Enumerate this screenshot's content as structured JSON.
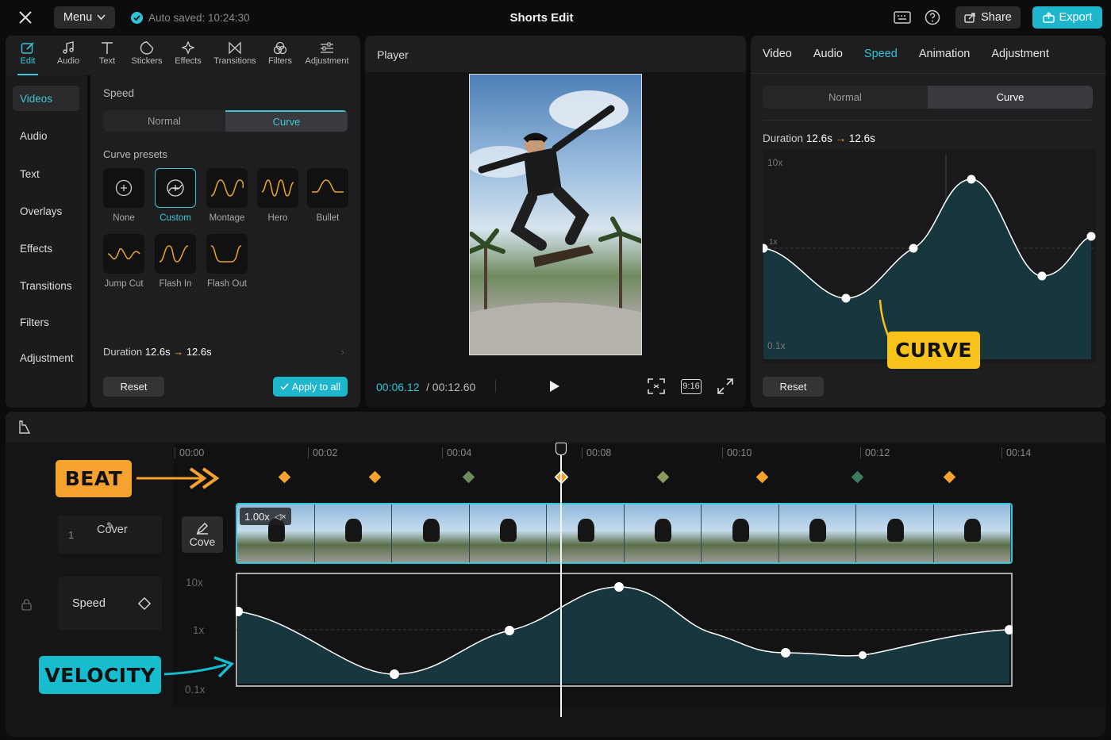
{
  "topbar": {
    "menu_label": "Menu",
    "autosave_text": "Auto saved: 10:24:30",
    "title": "Shorts Edit",
    "share_label": "Share",
    "export_label": "Export"
  },
  "tools": [
    {
      "label": "Edit",
      "icon": "edit-icon"
    },
    {
      "label": "Audio",
      "icon": "music-note-icon"
    },
    {
      "label": "Text",
      "icon": "text-icon"
    },
    {
      "label": "Stickers",
      "icon": "sticker-icon"
    },
    {
      "label": "Effects",
      "icon": "sparkle-icon"
    },
    {
      "label": "Transitions",
      "icon": "transition-icon"
    },
    {
      "label": "Filters",
      "icon": "filter-icon"
    },
    {
      "label": "Adjustment",
      "icon": "sliders-icon"
    }
  ],
  "sidebar": [
    "Videos",
    "Audio",
    "Text",
    "Overlays",
    "Effects",
    "Transitions",
    "Filters",
    "Adjustment"
  ],
  "speed_panel": {
    "heading": "Speed",
    "tab_normal": "Normal",
    "tab_curve": "Curve",
    "presets_heading": "Curve presets",
    "presets": [
      "None",
      "Custom",
      "Montage",
      "Hero",
      "Bullet",
      "Jump Cut",
      "Flash In",
      "Flash Out"
    ],
    "duration_label": "Duration",
    "duration_from": "12.6s",
    "duration_to": "12.6s",
    "reset_label": "Reset",
    "apply_label": "Apply to all"
  },
  "player": {
    "title": "Player",
    "current_time": "00:06.12",
    "total_time": "/ 00:12.60",
    "ratio_label": "9:16"
  },
  "right_panel": {
    "tabs": [
      "Video",
      "Audio",
      "Speed",
      "Animation",
      "Adjustment"
    ],
    "active_tab": "Speed",
    "tab_normal": "Normal",
    "tab_curve": "Curve",
    "duration_label": "Duration",
    "duration_from": "12.6s",
    "duration_to": "12.6s",
    "y_top": "10x",
    "y_mid": "1x",
    "y_bottom": "0.1x",
    "reset_label": "Reset",
    "callout": "CURVE"
  },
  "timeline": {
    "ticks": [
      "00:00",
      "00:02",
      "00:04",
      "00:08",
      "00:10",
      "00:12",
      "00:14"
    ],
    "beat_callout": "BEAT",
    "velocity_callout": "VELOCITY",
    "track_index": "1",
    "cover_label": "Cover",
    "cover_edit_label": "Cove",
    "clip_speed": "1.00x",
    "speed_track_label": "Speed",
    "y_top": "10x",
    "y_mid": "1x",
    "y_bottom": "0.1x"
  },
  "colors": {
    "accent": "#2fc4d8",
    "beat": "#f6a22e",
    "callout_yellow": "#f7c21a",
    "velocity": "#17bccf",
    "curve_fill": "#17363d"
  }
}
